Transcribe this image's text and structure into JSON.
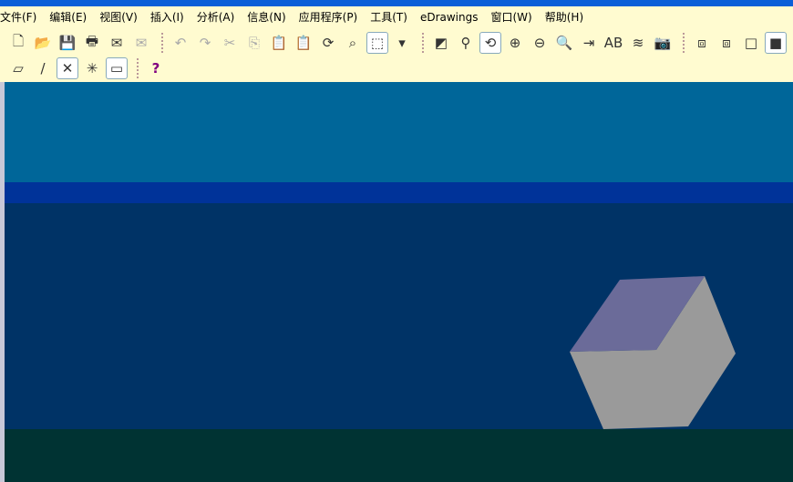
{
  "menu": [
    "文件(F)",
    "编辑(E)",
    "视图(V)",
    "插入(I)",
    "分析(A)",
    "信息(N)",
    "应用程序(P)",
    "工具(T)",
    "eDrawings",
    "窗口(W)",
    "帮助(H)"
  ],
  "toolbar_row1": [
    {
      "name": "new-icon",
      "glyph": "🗋",
      "state": ""
    },
    {
      "name": "open-icon",
      "glyph": "📂",
      "state": ""
    },
    {
      "name": "save-icon",
      "glyph": "💾",
      "state": ""
    },
    {
      "name": "print-icon",
      "glyph": "🖶",
      "state": ""
    },
    {
      "name": "send-icon",
      "glyph": "✉",
      "state": ""
    },
    {
      "name": "send-disabled-icon",
      "glyph": "✉",
      "state": "dis"
    },
    {
      "sep": true
    },
    {
      "name": "undo-icon",
      "glyph": "↶",
      "state": "dis"
    },
    {
      "name": "redo-icon",
      "glyph": "↷",
      "state": "dis"
    },
    {
      "name": "cut-icon",
      "glyph": "✂",
      "state": "dis"
    },
    {
      "name": "copy-icon",
      "glyph": "⎘",
      "state": "dis"
    },
    {
      "name": "paste-icon",
      "glyph": "📋",
      "state": "dis"
    },
    {
      "name": "paste-special-icon",
      "glyph": "📋",
      "state": "dis"
    },
    {
      "name": "refresh-icon",
      "glyph": "⟳",
      "state": ""
    },
    {
      "name": "binoculars-icon",
      "glyph": "⌕",
      "state": ""
    },
    {
      "name": "select-box-icon",
      "glyph": "⬚",
      "state": "on"
    },
    {
      "name": "dropdown-arrow-icon",
      "glyph": "▾",
      "state": ""
    },
    {
      "sep": true
    },
    {
      "name": "fit-view-icon",
      "glyph": "◩",
      "state": ""
    },
    {
      "name": "node-icon",
      "glyph": "⚲",
      "state": ""
    },
    {
      "name": "rotate-view-icon",
      "glyph": "⟲",
      "state": "on"
    },
    {
      "name": "zoom-in-icon",
      "glyph": "⊕",
      "state": ""
    },
    {
      "name": "zoom-out-icon",
      "glyph": "⊖",
      "state": ""
    },
    {
      "name": "zoom-window-icon",
      "glyph": "🔍",
      "state": ""
    },
    {
      "name": "section-view-icon",
      "glyph": "⇥",
      "state": ""
    },
    {
      "name": "annotation-icon",
      "glyph": "AB",
      "state": ""
    },
    {
      "name": "layers-icon",
      "glyph": "≋",
      "state": ""
    },
    {
      "name": "snapshot-icon",
      "glyph": "📷",
      "state": ""
    },
    {
      "sep": true
    },
    {
      "name": "wireframe-icon",
      "glyph": "⧈",
      "state": ""
    },
    {
      "name": "hidden-lines-icon",
      "glyph": "⧈",
      "state": ""
    },
    {
      "name": "hidden-removed-icon",
      "glyph": "□",
      "state": ""
    },
    {
      "name": "shaded-icon",
      "glyph": "■",
      "state": "on"
    }
  ],
  "toolbar_row2": [
    {
      "name": "show-planes-icon",
      "glyph": "▱",
      "state": ""
    },
    {
      "name": "show-axes-icon",
      "glyph": "/",
      "state": ""
    },
    {
      "name": "show-points-icon",
      "glyph": "✕",
      "state": "on"
    },
    {
      "name": "show-coordinate-systems-icon",
      "glyph": "✳",
      "state": ""
    },
    {
      "name": "show-sketches-icon",
      "glyph": "▭",
      "state": "on"
    },
    {
      "sep": true
    },
    {
      "name": "whats-this-help-icon",
      "glyph": "?",
      "state": ""
    }
  ],
  "colors": {
    "sky": "#006699",
    "stripe": "#003399",
    "floor": "#003366",
    "ground": "#003333",
    "cube_top": "#6b6b99",
    "cube_side": "#9a9a9a"
  }
}
